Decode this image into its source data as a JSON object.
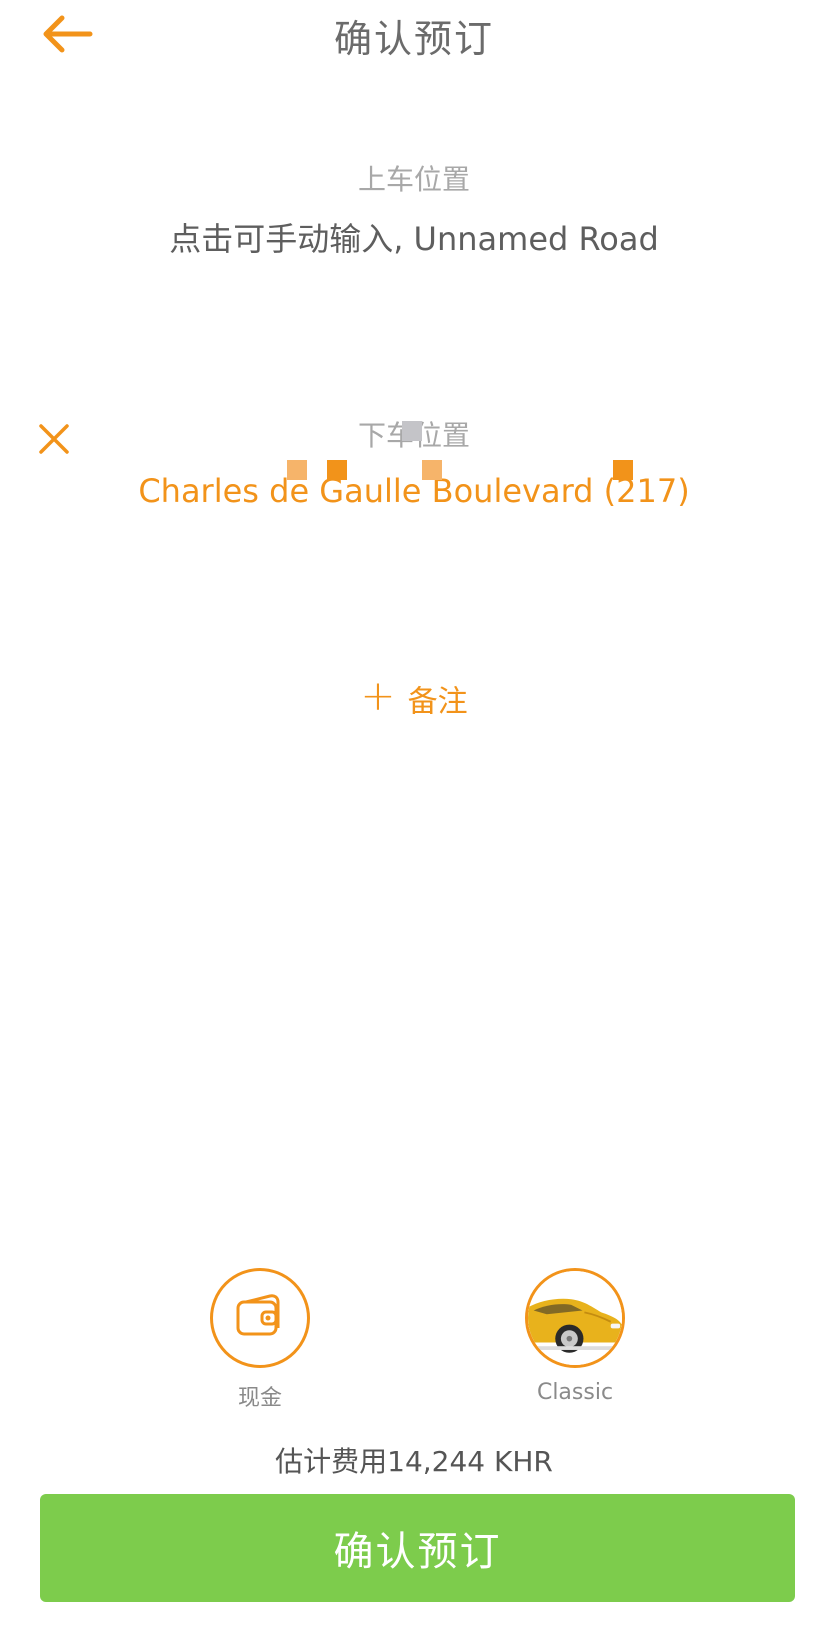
{
  "header": {
    "title": "确认预订"
  },
  "pickup": {
    "label": "上车位置",
    "value": "点击可手动输入, Unnamed Road"
  },
  "dropoff": {
    "label": "下车位置",
    "value": "Charles de Gaulle Boulevard (217)"
  },
  "note": {
    "icon": "plus-icon",
    "label": "备注"
  },
  "options": {
    "payment": {
      "icon": "wallet-icon",
      "label": "现金"
    },
    "vehicle": {
      "icon": "car-icon",
      "label": "Classic"
    }
  },
  "fare": {
    "text": "估计费用14,244 KHR"
  },
  "confirm": {
    "label": "确认预订"
  },
  "colors": {
    "accent": "#f2931a",
    "confirm": "#7dcc4c",
    "text": "#6b6b6b",
    "muted": "#a8a8a8"
  }
}
